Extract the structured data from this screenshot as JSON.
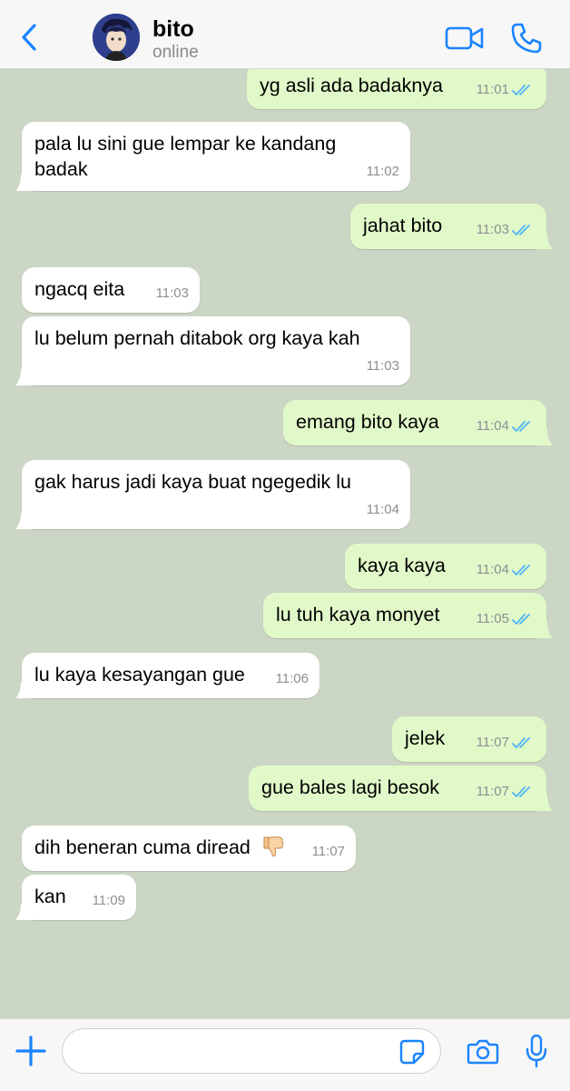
{
  "header": {
    "contact_name": "bito",
    "contact_status": "online"
  },
  "colors": {
    "accent": "#1a84ff",
    "chat_background": "#ccd6c4",
    "incoming_bubble": "#ffffff",
    "outgoing_bubble": "#e1f9c9",
    "read_ticks": "#4fb3f7"
  },
  "messages": [
    {
      "dir": "out",
      "text": "yg asli ada badaknya",
      "time": "11:01",
      "read": true
    },
    {
      "dir": "in",
      "text_lines": [
        "pala lu sini gue lempar ke kandang",
        "badak"
      ],
      "time": "11:02"
    },
    {
      "dir": "out",
      "text": "jahat bito",
      "time": "11:03",
      "read": true
    },
    {
      "dir": "in",
      "text": "ngacq eita",
      "time": "11:03"
    },
    {
      "dir": "in",
      "text": "lu belum pernah ditabok org kaya kah",
      "time": "11:03"
    },
    {
      "dir": "out",
      "text": "emang bito kaya",
      "time": "11:04",
      "read": true
    },
    {
      "dir": "in",
      "text": "gak harus jadi kaya buat ngegedik lu",
      "time": "11:04"
    },
    {
      "dir": "out",
      "text": "kaya kaya",
      "time": "11:04",
      "read": true
    },
    {
      "dir": "out",
      "text": "lu tuh kaya monyet",
      "time": "11:05",
      "read": true
    },
    {
      "dir": "in",
      "text": "lu kaya kesayangan gue",
      "time": "11:06"
    },
    {
      "dir": "out",
      "text": "jelek",
      "time": "11:07",
      "read": true
    },
    {
      "dir": "out",
      "text": "gue bales lagi besok",
      "time": "11:07",
      "read": true
    },
    {
      "dir": "in",
      "text": "dih beneran cuma diread",
      "emoji": "thumbs-down-icon",
      "time": "11:07"
    },
    {
      "dir": "in",
      "text": "kan",
      "time": "11:09"
    }
  ],
  "input": {
    "placeholder": "",
    "value": ""
  },
  "icons": {
    "back": "chevron-left-icon",
    "video": "video-camera-icon",
    "call": "phone-icon",
    "add": "plus-icon",
    "sticker": "sticker-icon",
    "camera": "camera-icon",
    "mic": "microphone-icon"
  }
}
